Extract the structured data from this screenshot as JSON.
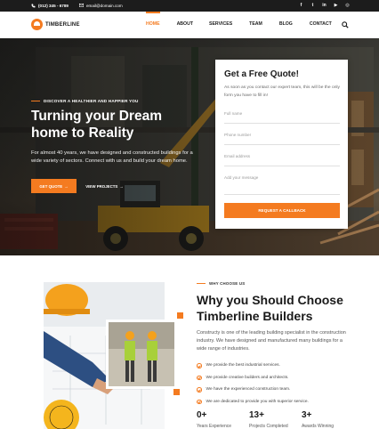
{
  "topbar": {
    "phone": "(012) 345 - 6789",
    "email": "email@domain.com",
    "social": [
      {
        "icon": "facebook-icon",
        "glyph": "f"
      },
      {
        "icon": "twitter-icon",
        "glyph": "t"
      },
      {
        "icon": "linkedin-icon",
        "glyph": "in"
      },
      {
        "icon": "youtube-icon",
        "glyph": "▶"
      },
      {
        "icon": "instagram-icon",
        "glyph": "◎"
      }
    ]
  },
  "nav": {
    "brand": "TIMBERLINE",
    "items": [
      "HOME",
      "ABOUT",
      "SERVICES",
      "TEAM",
      "BLOG",
      "CONTACT"
    ],
    "active": "HOME"
  },
  "hero": {
    "eyebrow": "DISCOVER A HEALTHIER AND HAPPIER YOU",
    "title": "Turning your Dream home to Reality",
    "lead": "For almost 40 years, we have designed and constructed buildings for a wide variety of sectors. Connect with us and build your dream home.",
    "primary_button": "GET QUOTE",
    "secondary_button": "VIEW PROJECTS"
  },
  "quote": {
    "title": "Get a Free Quote!",
    "subtitle": "As soon as you contact our expert team, this will be the only form you have to fill in!",
    "name_placeholder": "Full name",
    "phone_placeholder": "Phone number",
    "email_placeholder": "Email address",
    "message_placeholder": "Add your message",
    "submit": "REQUEST A CALLBACK"
  },
  "why": {
    "eyebrow": "WHY CHOOSE US",
    "title": "Why you Should Choose Timberline Builders",
    "description": "Constructy is one of the leading building specialist in the construction industry. We have designed and manufactured many buildings for a wide range of industries.",
    "checks": [
      "We provide the best industrial services.",
      "We provide creative builders and architects.",
      "We have the experienced construction team.",
      "We are dedicated to provide you with superior service."
    ],
    "stats": [
      {
        "value": "0+",
        "label": "Years Experience"
      },
      {
        "value": "13+",
        "label": "Projects Completed"
      },
      {
        "value": "3+",
        "label": "Awards Winning"
      }
    ]
  },
  "colors": {
    "accent": "#f47b20",
    "dark": "#1c1c1c"
  }
}
